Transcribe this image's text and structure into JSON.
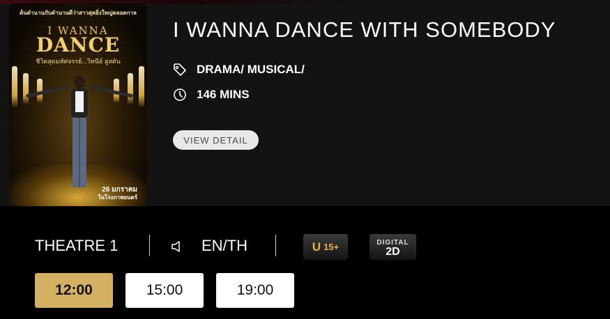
{
  "poster": {
    "tagline": "ต้นตำนานกับตำนานดีว่าสาวสุดยิ่งใหญ่ตลอดกาล",
    "title_line1": "I WANNA",
    "title_line2": "DANCE",
    "title_line3": "ชีวิตสุดมหัศจรรย์...วิทนีย์ ฮูสตัน",
    "release_line1": "26 มกราคม",
    "release_line2": "ในโรงภาพยนตร์"
  },
  "movie": {
    "title": "I WANNA DANCE WITH SOMEBODY",
    "genre": "DRAMA/ MUSICAL/",
    "duration": "146 MINS",
    "view_detail_label": "VIEW DETAIL"
  },
  "showing": {
    "theatre": "THEATRE 1",
    "language": "EN/TH",
    "rating_letter": "U",
    "rating_age": "15+",
    "format_top": "DIGITAL",
    "format_main": "2D"
  },
  "showtimes": [
    "12:00",
    "15:00",
    "19:00"
  ],
  "colors": {
    "accent": "#d4b062",
    "panel": "#131313",
    "background": "#000000"
  },
  "icons": {
    "genre": "tag-icon",
    "duration": "clock-icon",
    "audio": "speaker-icon"
  }
}
